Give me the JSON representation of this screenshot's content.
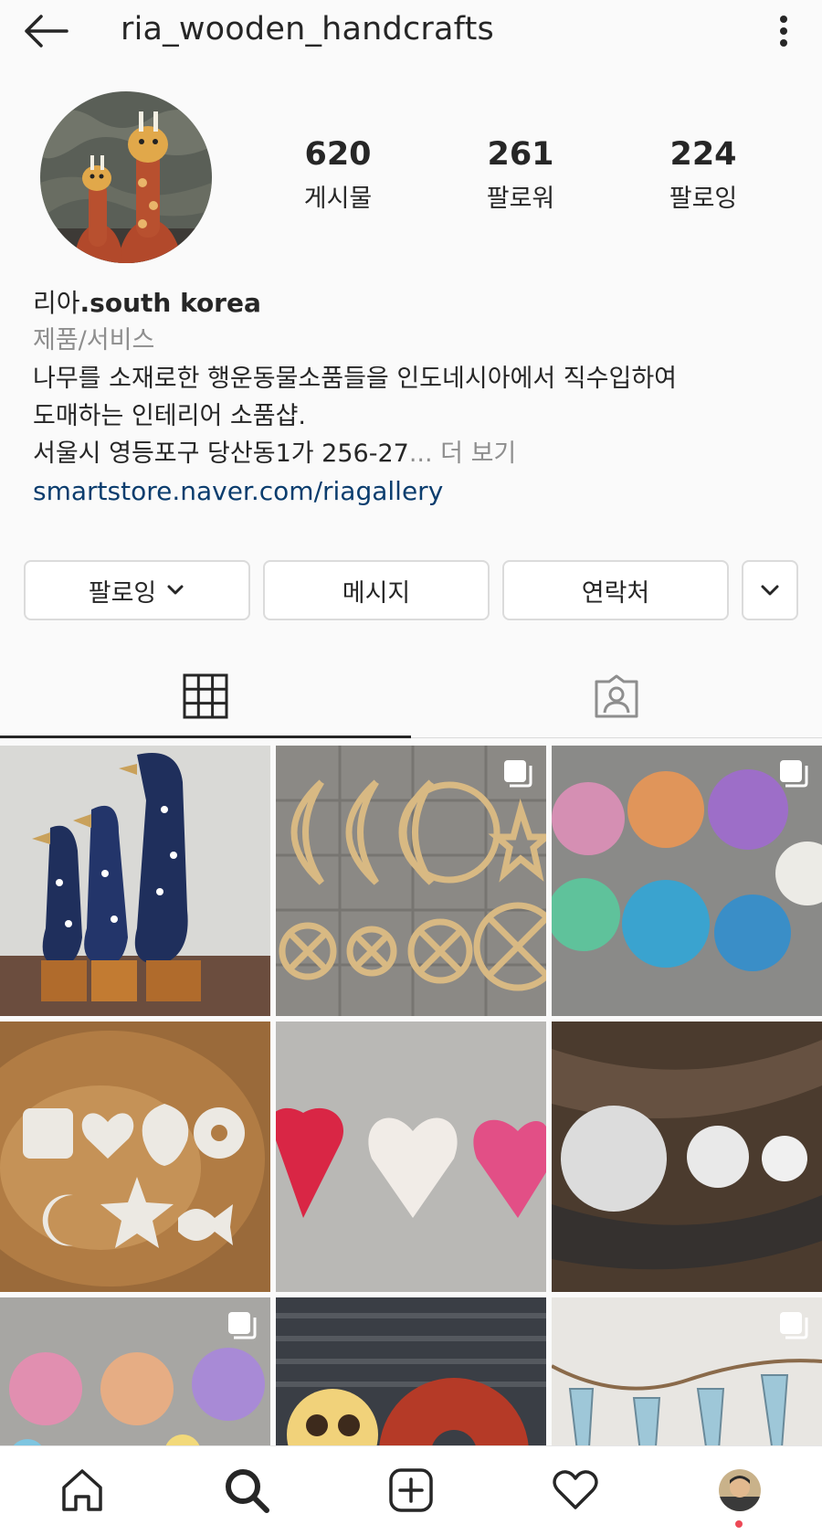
{
  "header": {
    "username": "ria_wooden_handcrafts",
    "back_icon": "arrow-left-icon",
    "more_icon": "more-vertical-icon"
  },
  "profile": {
    "stats": [
      {
        "value": "620",
        "label": "게시물"
      },
      {
        "value": "261",
        "label": "팔로워"
      },
      {
        "value": "224",
        "label": "팔로잉"
      }
    ],
    "name_prefix": "리아",
    "name_suffix": ".south korea",
    "category": "제품/서비스",
    "bio_line1": "나무를 소재로한 행운동물소품들을 인도네시아에서 직수입하여",
    "bio_line2": "도매하는 인테리어 소품샵.",
    "bio_line3": "서울시 영등포구 당산동1가 256-27",
    "bio_more": "... 더 보기",
    "link": "smartstore.naver.com/riagallery"
  },
  "actions": {
    "following_label": "팔로잉",
    "message_label": "메시지",
    "contact_label": "연락처"
  },
  "tabs": [
    {
      "icon": "grid-icon",
      "active": true
    },
    {
      "icon": "tagged-user-icon",
      "active": false
    }
  ],
  "posts": [
    {
      "subject": "wooden ducks",
      "multi": false
    },
    {
      "subject": "dreamcatcher rings",
      "multi": true
    },
    {
      "subject": "capiz shell bundles",
      "multi": true
    },
    {
      "subject": "shell shapes on wood",
      "multi": false
    },
    {
      "subject": "capiz hearts",
      "multi": false
    },
    {
      "subject": "capiz discs on wood",
      "multi": false
    },
    {
      "subject": "capiz shell chips",
      "multi": true
    },
    {
      "subject": "lamps display",
      "multi": false
    },
    {
      "subject": "shell garland",
      "multi": true
    }
  ],
  "bottom_nav": [
    {
      "icon": "home-icon"
    },
    {
      "icon": "search-icon"
    },
    {
      "icon": "new-post-icon"
    },
    {
      "icon": "activity-heart-icon"
    },
    {
      "icon": "profile-avatar-icon"
    }
  ],
  "colors": {
    "text": "#262626",
    "secondary": "#8e8e8e",
    "link": "#0b3d6e",
    "border": "#dbdbdb",
    "notification_dot": "#ed4956"
  }
}
